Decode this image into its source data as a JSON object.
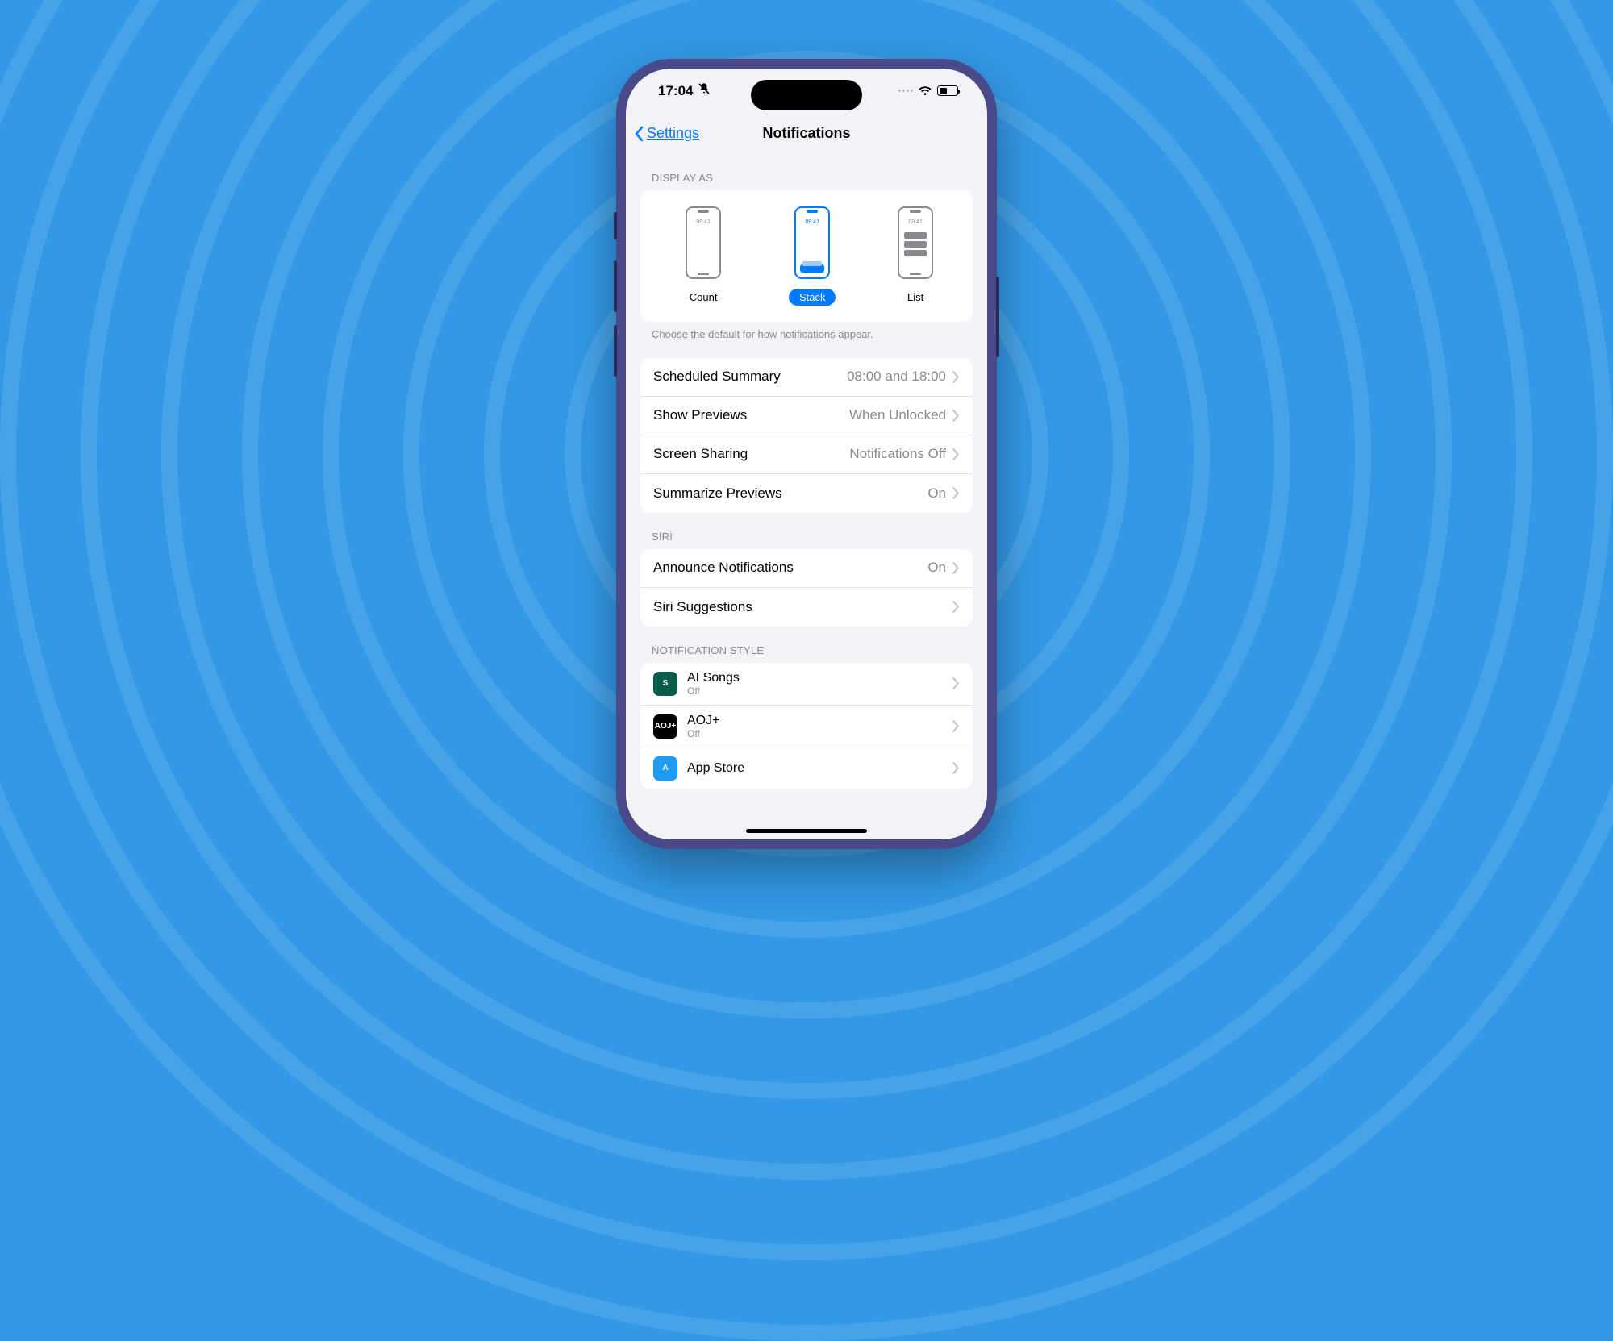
{
  "status": {
    "time": "17:04"
  },
  "nav": {
    "back": "Settings",
    "title": "Notifications"
  },
  "display_as": {
    "header": "DISPLAY AS",
    "footer": "Choose the default for how notifications appear.",
    "mini_time": "09:41",
    "options": [
      {
        "label": "Count",
        "selected": false
      },
      {
        "label": "Stack",
        "selected": true
      },
      {
        "label": "List",
        "selected": false
      }
    ]
  },
  "prefs": [
    {
      "label": "Scheduled Summary",
      "value": "08:00 and 18:00"
    },
    {
      "label": "Show Previews",
      "value": "When Unlocked"
    },
    {
      "label": "Screen Sharing",
      "value": "Notifications Off"
    },
    {
      "label": "Summarize Previews",
      "value": "On"
    }
  ],
  "siri": {
    "header": "SIRI",
    "rows": [
      {
        "label": "Announce Notifications",
        "value": "On"
      },
      {
        "label": "Siri Suggestions",
        "value": ""
      }
    ]
  },
  "style": {
    "header": "NOTIFICATION STYLE",
    "apps": [
      {
        "name": "AI Songs",
        "status": "Off",
        "bg": "#0a5c4a",
        "glyph": "S"
      },
      {
        "name": "AOJ+",
        "status": "Off",
        "bg": "#000000",
        "glyph": "AOJ+"
      },
      {
        "name": "App Store",
        "status": "",
        "bg": "#1e9af1",
        "glyph": "A"
      }
    ]
  }
}
